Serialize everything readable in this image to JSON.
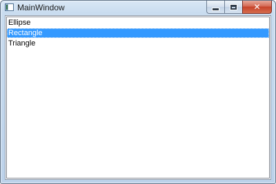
{
  "window": {
    "title": "MainWindow",
    "icon": "app-window-icon",
    "caption_buttons": {
      "minimize_glyph": "minimize-icon",
      "maximize_glyph": "maximize-icon",
      "close_glyph": "✕"
    }
  },
  "listbox": {
    "items": [
      {
        "label": "Ellipse",
        "selected": false
      },
      {
        "label": "Rectangle",
        "selected": true
      },
      {
        "label": "Triangle",
        "selected": false
      }
    ],
    "selection_color": "#3399ff"
  }
}
